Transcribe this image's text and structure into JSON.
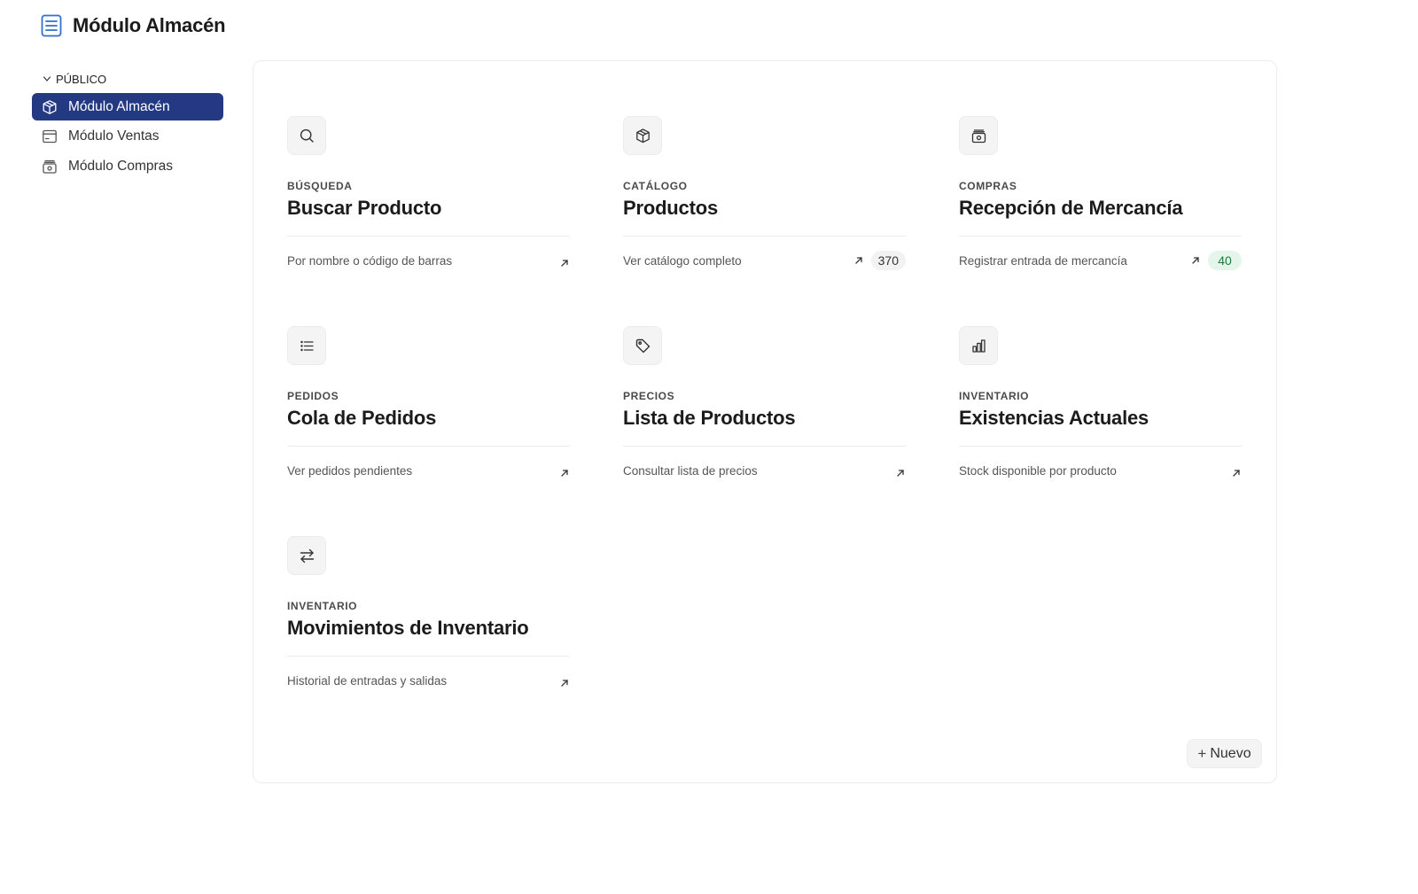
{
  "header": {
    "title": "Módulo Almacén",
    "icon": "document-list-icon",
    "accent": "#2f6fcf"
  },
  "sidebar": {
    "section_label": "PÚBLICO",
    "items": [
      {
        "label": "Módulo Almacén",
        "icon": "box-icon",
        "active": true
      },
      {
        "label": "Módulo Ventas",
        "icon": "window-icon",
        "active": false
      },
      {
        "label": "Módulo Compras",
        "icon": "cash-register-icon",
        "active": false
      }
    ],
    "active_color": "#233a83"
  },
  "cards": [
    {
      "category": "BÚSQUEDA",
      "title": "Buscar Producto",
      "description": "Por nombre o código de barras",
      "icon": "search-icon"
    },
    {
      "category": "CATÁLOGO",
      "title": "Productos",
      "description": "Ver catálogo completo",
      "icon": "box-icon",
      "badge": "370"
    },
    {
      "category": "COMPRAS",
      "title": "Recepción de Mercancía",
      "description": "Registrar entrada de mercancía",
      "icon": "cash-register-icon",
      "badge": "40"
    },
    {
      "category": "PEDIDOS",
      "title": "Cola de Pedidos",
      "description": "Ver pedidos pendientes",
      "icon": "list-icon"
    },
    {
      "category": "PRECIOS",
      "title": "Lista de Productos",
      "description": "Consultar lista de precios",
      "icon": "tag-icon"
    },
    {
      "category": "INVENTARIO",
      "title": "Existencias Actuales",
      "description": "Stock disponible por producto",
      "icon": "bar-chart-icon"
    },
    {
      "category": "INVENTARIO",
      "title": "Movimientos de Inventario",
      "description": "Historial de entradas y salidas",
      "icon": "swap-arrows-icon"
    }
  ],
  "new_button": {
    "label": "Nuevo",
    "icon": "plus-icon"
  }
}
